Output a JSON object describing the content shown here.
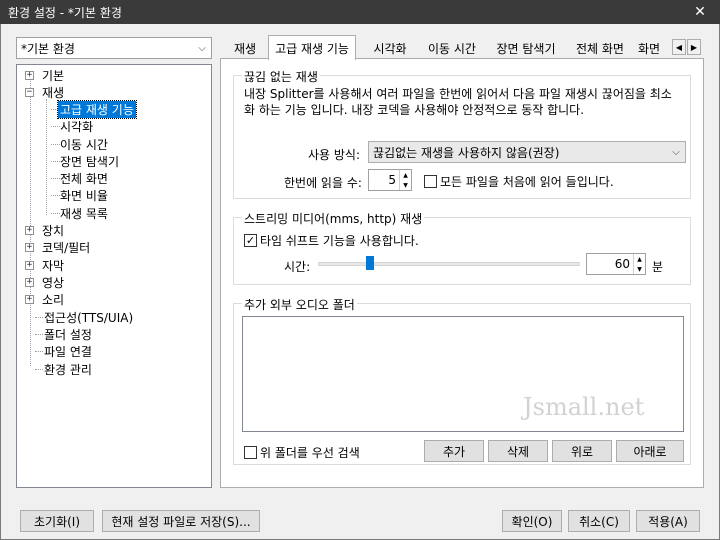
{
  "window": {
    "title": "환경 설정 - *기본 환경",
    "close_glyph": "✕"
  },
  "profile": {
    "selected": "*기본 환경"
  },
  "tree": {
    "items": [
      {
        "label": "기본",
        "expander": "+"
      },
      {
        "label": "재생",
        "expander": "−"
      },
      {
        "label": "고급 재생 기능"
      },
      {
        "label": "시각화"
      },
      {
        "label": "이동 시간"
      },
      {
        "label": "장면 탐색기"
      },
      {
        "label": "전체 화면"
      },
      {
        "label": "화면 비율"
      },
      {
        "label": "재생 목록"
      },
      {
        "label": "장치",
        "expander": "+"
      },
      {
        "label": "코덱/필터",
        "expander": "+"
      },
      {
        "label": "자막",
        "expander": "+"
      },
      {
        "label": "영상",
        "expander": "+"
      },
      {
        "label": "소리",
        "expander": "+"
      },
      {
        "label": "접근성(TTS/UIA)"
      },
      {
        "label": "폴더 설정"
      },
      {
        "label": "파일 연결"
      },
      {
        "label": "환경 관리"
      }
    ]
  },
  "tabs": [
    {
      "label": "재생"
    },
    {
      "label": "고급 재생 기능"
    },
    {
      "label": "시각화"
    },
    {
      "label": "이동 시간"
    },
    {
      "label": "장면 탐색기"
    },
    {
      "label": "전체 화면"
    },
    {
      "label": "화면"
    }
  ],
  "seamless": {
    "title": "끊김 없는 재생",
    "desc_line1": "내장 Splitter를 사용해서 여러 파일을 한번에 읽어서 다음 파일 재생시 끊어짐을 최소",
    "desc_line2": "화 하는 기능 입니다. 내장 코덱을 사용해야 안정적으로 동작 합니다.",
    "method_label": "사용 방식:",
    "method_value": "끊김없는 재생을 사용하지 않음(권장)",
    "read_label": "한번에 읽을 수:",
    "read_value": "5",
    "read_all_label": "모든 파일을 처음에 읽어 들입니다."
  },
  "streaming": {
    "title": "스트리밍 미디어(mms, http) 재생",
    "timeshift_label": "타임 쉬프트 기능을 사용합니다.",
    "timeshift_checked": true,
    "time_label": "시간:",
    "time_value": "60",
    "time_unit": "분",
    "slider_fraction": 0.2
  },
  "audio_folders": {
    "title": "추가 외부 오디오 폴더",
    "watermark": "Jsmall.net",
    "priority_label": "위 폴더를 우선 검색",
    "add": "추가",
    "delete": "삭제",
    "up": "위로",
    "down": "아래로"
  },
  "footer": {
    "reset": "초기화(I)",
    "save_current": "현재 설정 파일로 저장(S)...",
    "ok": "확인(O)",
    "cancel": "취소(C)",
    "apply": "적용(A)"
  },
  "colors": {
    "selection": "#0078d7",
    "titlebar": "#3a3a3a"
  }
}
